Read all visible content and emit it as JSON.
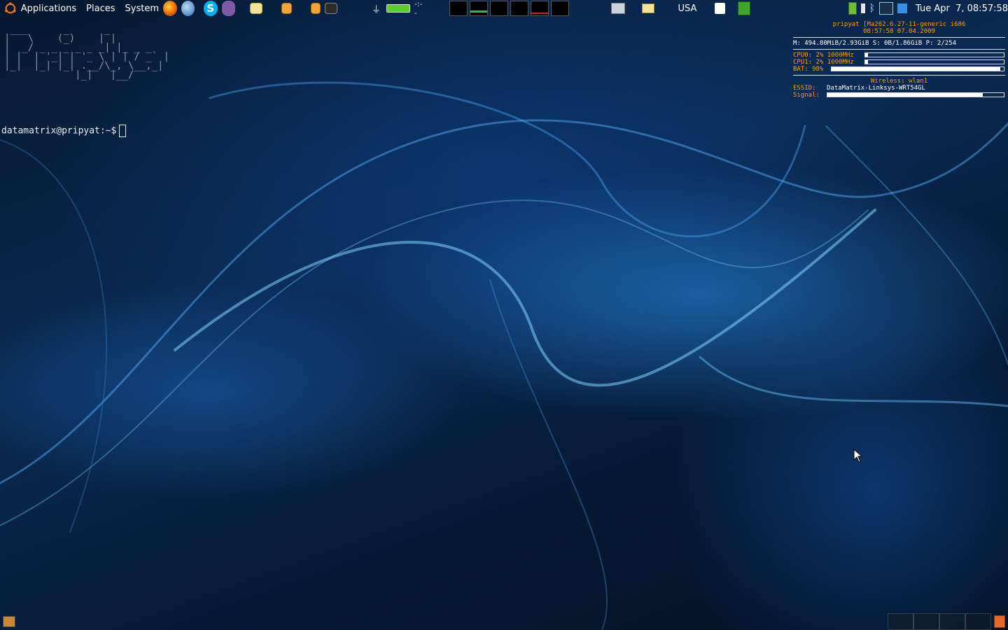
{
  "top_panel": {
    "menus": [
      "Applications",
      "Places",
      "System"
    ],
    "battery_time": "-:--",
    "keyboard_layout": "USA",
    "clock": "Tue Apr  7, 08:57:58"
  },
  "icons": {
    "ubuntu_logo": "ubuntu-logo-icon",
    "launchers": [
      "firefox-icon",
      "thunderbird-icon",
      "skype-icon",
      "pidgin-icon",
      "folder-icon",
      "presentation-icon",
      "document-icon",
      "terminal-icon"
    ],
    "tray": [
      "network-icon",
      "battery-icon",
      "bluetooth-icon",
      "monitor-icon",
      "app-icon"
    ]
  },
  "conky": {
    "line1": "pripyat [Ma262.6.27-11-generic i686",
    "line2": "08:57:58 07.04.2009",
    "memory": "M: 494.80MiB/2.93GiB S: 0B/1.86GiB P: 2/254",
    "cpu0_label": "CPU0: 2% 1000MHz",
    "cpu0_pct": 0.02,
    "cpu1_label": "CPU1: 2% 1000MHz",
    "cpu1_pct": 0.02,
    "bat_label": "BAT: 98%",
    "bat_pct": 0.98,
    "wireless_title": "Wireless: wlan1",
    "essid_label": "ESSID:",
    "essid": "DataMatrix-Linksys-WRT54GL",
    "signal_label": "Signal:",
    "signal_pct": 0.88
  },
  "terminal": {
    "ascii_art": " ___      _      _\n|   \\    (_)    | |\n|  _/ _ _ _ _ _ _| |_ _ _\n| |  | '_| | '_ \\ | | / _` |\n|_|  |_| |_| .__/\\_, \\__,_|\n            |_|   |__/",
    "prompt": "datamatrix@pripyat:~$"
  },
  "colors": {
    "conky_orange": "#ff9d00",
    "battery_green": "#5dcc2e"
  }
}
